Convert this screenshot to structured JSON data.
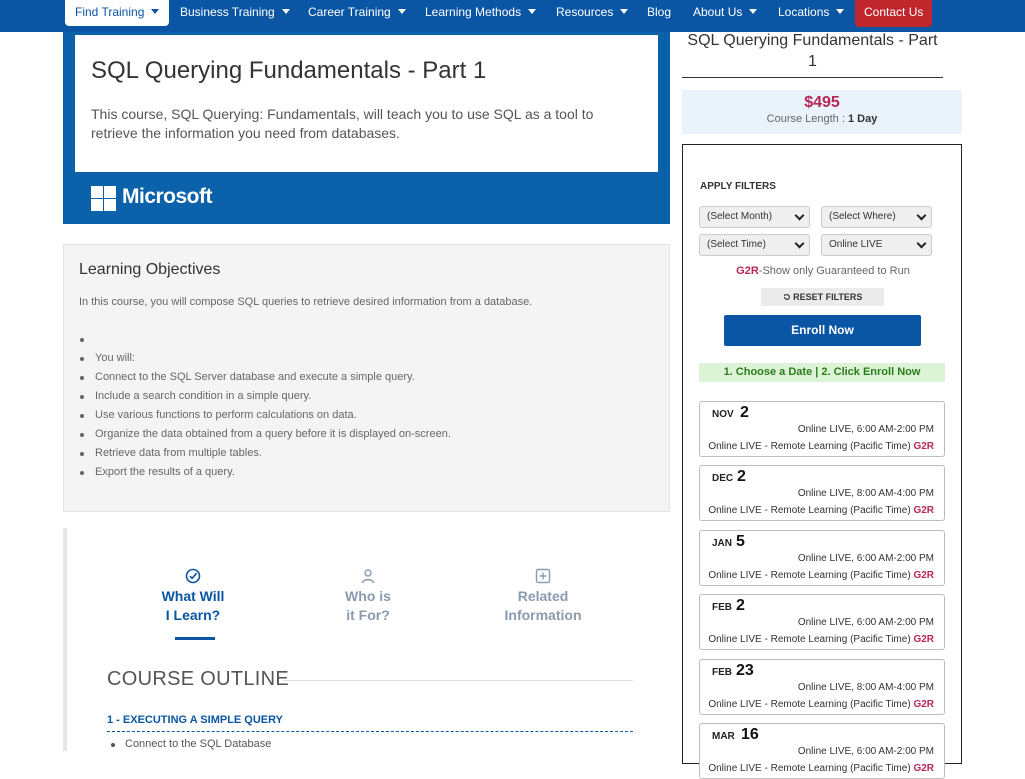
{
  "nav": {
    "items": [
      {
        "label": "Find Training",
        "dropdown": true
      },
      {
        "label": "Business Training",
        "dropdown": true
      },
      {
        "label": "Career Training",
        "dropdown": true
      },
      {
        "label": "Learning Methods",
        "dropdown": true
      },
      {
        "label": "Resources",
        "dropdown": true
      },
      {
        "label": "Blog",
        "dropdown": false
      },
      {
        "label": "About Us",
        "dropdown": true
      },
      {
        "label": "Locations",
        "dropdown": true
      }
    ],
    "contact_label": "Contact Us"
  },
  "hero": {
    "title": "SQL Querying Fundamentals - Part 1",
    "description": "This course, SQL Querying: Fundamentals, will teach you to use SQL as a tool to retrieve the information you need from databases.",
    "brand": "Microsoft"
  },
  "objectives": {
    "title": "Learning Objectives",
    "intro": "In this course, you will compose SQL queries to retrieve desired information from a database.",
    "items": [
      "",
      "You will:",
      "Connect to the SQL Server database and execute a simple query.",
      "Include a search condition in a simple query.",
      "Use various functions to perform calculations on data.",
      "Organize the data obtained from a query before it is displayed on-screen.",
      "Retrieve data from multiple tables.",
      "Export the results of a query."
    ]
  },
  "tabs": [
    {
      "line1": "What Will",
      "line2": "I Learn?",
      "icon": "check-circle-icon"
    },
    {
      "line1": "Who is",
      "line2": "it For?",
      "icon": "user-icon"
    },
    {
      "line1": "Related",
      "line2": "Information",
      "icon": "plus-square-icon"
    }
  ],
  "outline": {
    "title": "COURSE OUTLINE",
    "section1": "1 - EXECUTING A SIMPLE QUERY",
    "item1": "Connect to the SQL Database"
  },
  "sidebar": {
    "title": "SQL Querying Fundamentals - Part 1",
    "price": "$495",
    "course_length_label": "Course Length :",
    "course_length_value": "1 Day",
    "filters_label": "APPLY FILTERS",
    "select_month": "(Select Month)",
    "select_where": "(Select Where)",
    "select_time": "(Select Time)",
    "select_online": "Online LIVE",
    "g2r_code": "G2R",
    "g2r_text": "-Show only Guaranteed to Run",
    "reset_label": "RESET FILTERS",
    "enroll_label": "Enroll Now",
    "choose_label": "1. Choose a Date | 2. Click Enroll Now",
    "dates": [
      {
        "month": "NOV",
        "day": "2",
        "time": "Online LIVE, 6:00 AM-2:00 PM",
        "location": "Online LIVE - Remote Learning (Pacific Time)",
        "badge": "G2R"
      },
      {
        "month": "DEC",
        "day": "2",
        "time": "Online LIVE, 8:00 AM-4:00 PM",
        "location": "Online LIVE - Remote Learning (Pacific Time)",
        "badge": "G2R"
      },
      {
        "month": "JAN",
        "day": "5",
        "time": "Online LIVE, 6:00 AM-2:00 PM",
        "location": "Online LIVE - Remote Learning (Pacific Time)",
        "badge": "G2R"
      },
      {
        "month": "FEB",
        "day": "2",
        "time": "Online LIVE, 6:00 AM-2:00 PM",
        "location": "Online LIVE - Remote Learning (Pacific Time)",
        "badge": "G2R"
      },
      {
        "month": "FEB",
        "day": "23",
        "time": "Online LIVE, 8:00 AM-4:00 PM",
        "location": "Online LIVE - Remote Learning (Pacific Time)",
        "badge": "G2R"
      },
      {
        "month": "MAR",
        "day": "16",
        "time": "Online LIVE, 6:00 AM-2:00 PM",
        "location": "Online LIVE - Remote Learning (Pacific Time)",
        "badge": "G2R"
      }
    ]
  }
}
